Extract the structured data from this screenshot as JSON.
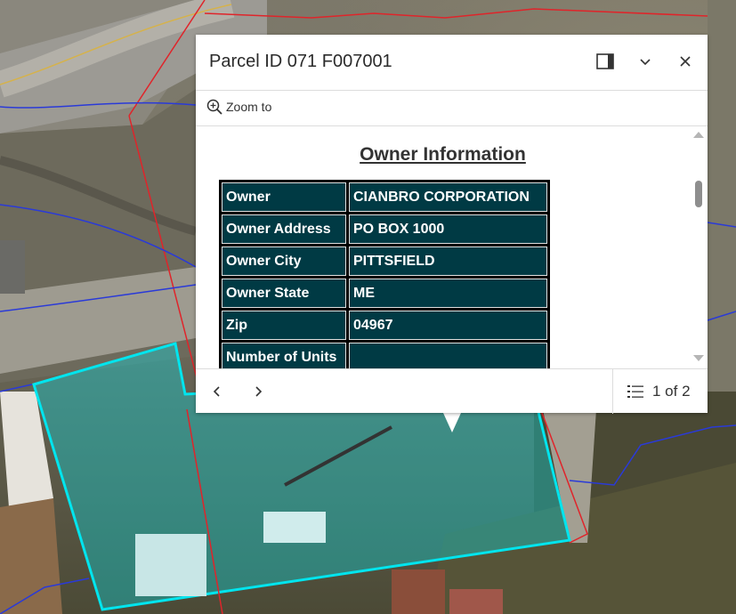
{
  "popup": {
    "title": "Parcel ID 071 F007001",
    "zoom_to_label": "Zoom to",
    "heading": "Owner Information",
    "rows": [
      {
        "key": "Owner",
        "value": "CIANBRO CORPORATION"
      },
      {
        "key": "Owner Address",
        "value": "PO BOX 1000"
      },
      {
        "key": "Owner City",
        "value": "PITTSFIELD"
      },
      {
        "key": "Owner State",
        "value": "ME"
      },
      {
        "key": "Zip",
        "value": "04967"
      },
      {
        "key": "Number of Units",
        "value": ""
      }
    ],
    "pager_text": "1 of 2"
  },
  "icons": {
    "dock": "dock-icon",
    "collapse": "chevron-down-icon",
    "close": "close-icon",
    "zoom": "zoom-in-icon",
    "prev": "chevron-left-icon",
    "next": "chevron-right-icon",
    "list": "feature-list-icon"
  },
  "colors": {
    "table_cell_bg": "#003a44",
    "parcel_highlight": "#00e5ee",
    "parcel_lines_red": "#e0242a",
    "parcel_lines_blue": "#2a3ad8"
  }
}
